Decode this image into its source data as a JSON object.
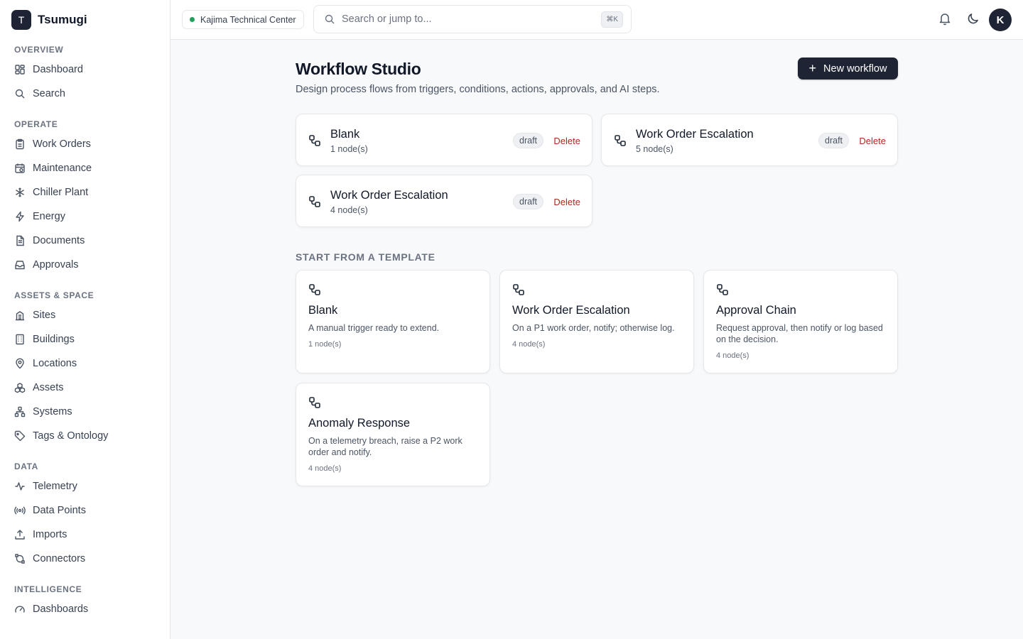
{
  "brand": {
    "logo_letter": "T",
    "name": "Tsumugi"
  },
  "sidebar": {
    "sections": [
      {
        "label": "OVERVIEW",
        "items": [
          {
            "label": "Dashboard",
            "icon": "dashboard-icon"
          },
          {
            "label": "Search",
            "icon": "search-icon"
          }
        ]
      },
      {
        "label": "OPERATE",
        "items": [
          {
            "label": "Work Orders",
            "icon": "clipboard-icon"
          },
          {
            "label": "Maintenance",
            "icon": "calendar-clock-icon"
          },
          {
            "label": "Chiller Plant",
            "icon": "snowflake-icon"
          },
          {
            "label": "Energy",
            "icon": "bolt-icon"
          },
          {
            "label": "Documents",
            "icon": "document-icon"
          },
          {
            "label": "Approvals",
            "icon": "inbox-icon"
          }
        ]
      },
      {
        "label": "ASSETS & SPACE",
        "items": [
          {
            "label": "Sites",
            "icon": "site-icon"
          },
          {
            "label": "Buildings",
            "icon": "building-icon"
          },
          {
            "label": "Locations",
            "icon": "map-pin-icon"
          },
          {
            "label": "Assets",
            "icon": "boxes-icon"
          },
          {
            "label": "Systems",
            "icon": "network-icon"
          },
          {
            "label": "Tags & Ontology",
            "icon": "tag-icon"
          }
        ]
      },
      {
        "label": "DATA",
        "items": [
          {
            "label": "Telemetry",
            "icon": "activity-icon"
          },
          {
            "label": "Data Points",
            "icon": "radio-icon"
          },
          {
            "label": "Imports",
            "icon": "upload-icon"
          },
          {
            "label": "Connectors",
            "icon": "plug-icon"
          }
        ]
      },
      {
        "label": "INTELLIGENCE",
        "items": [
          {
            "label": "Dashboards",
            "icon": "gauge-icon"
          }
        ]
      }
    ]
  },
  "topbar": {
    "site": "Kajima Technical Center",
    "search_placeholder": "Search or jump to...",
    "shortcut": "⌘K",
    "avatar_letter": "K"
  },
  "page": {
    "title": "Workflow Studio",
    "subtitle": "Design process flows from triggers, conditions, actions, approvals, and AI steps.",
    "new_button": "New workflow"
  },
  "workflows": [
    {
      "name": "Blank",
      "nodes": "1 node(s)",
      "status": "draft",
      "delete_label": "Delete"
    },
    {
      "name": "Work Order Escalation",
      "nodes": "5 node(s)",
      "status": "draft",
      "delete_label": "Delete"
    },
    {
      "name": "Work Order Escalation",
      "nodes": "4 node(s)",
      "status": "draft",
      "delete_label": "Delete"
    }
  ],
  "templates_label": "START FROM A TEMPLATE",
  "templates": [
    {
      "name": "Blank",
      "description": "A manual trigger ready to extend.",
      "nodes": "1 node(s)"
    },
    {
      "name": "Work Order Escalation",
      "description": "On a P1 work order, notify; otherwise log.",
      "nodes": "4 node(s)"
    },
    {
      "name": "Approval Chain",
      "description": "Request approval, then notify or log based on the decision.",
      "nodes": "4 node(s)"
    },
    {
      "name": "Anomaly Response",
      "description": "On a telemetry breach, raise a P2 work order and notify.",
      "nodes": "4 node(s)"
    }
  ],
  "colors": {
    "primary": "#1e2433",
    "danger": "#b3261e",
    "status_online": "#22a05a"
  }
}
